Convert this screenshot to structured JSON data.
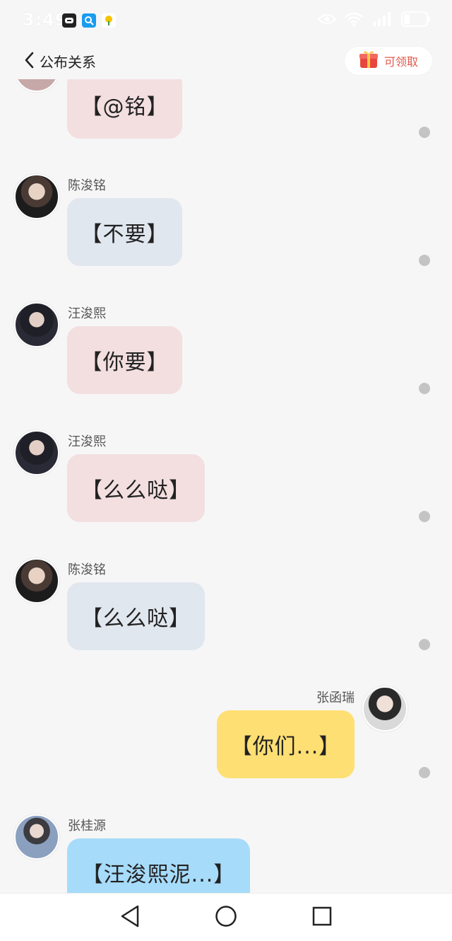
{
  "status": {
    "time": "3:49",
    "apps": [
      "meituan-icon",
      "qq-browser-icon",
      "tencent-news-icon"
    ],
    "right_icons": [
      "eye-icon",
      "wifi-icon",
      "signal-icon",
      "battery-icon"
    ]
  },
  "header": {
    "back_label": "公布关系",
    "claim_label": "可领取"
  },
  "messages": [
    {
      "name": "",
      "text": "【@铭】",
      "side": "left",
      "bubble_color": "#f3dfe0"
    },
    {
      "name": "陈浚铭",
      "text": "【不要】",
      "side": "left",
      "bubble_color": "#e1e7ef"
    },
    {
      "name": "汪浚熙",
      "text": "【你要】",
      "side": "left",
      "bubble_color": "#f3dfe0"
    },
    {
      "name": "汪浚熙",
      "text": "【么么哒】",
      "side": "left",
      "bubble_color": "#f3dfe0"
    },
    {
      "name": "陈浚铭",
      "text": "【么么哒】",
      "side": "left",
      "bubble_color": "#e1e7ef"
    },
    {
      "name": "张函瑞",
      "text": "【你们...】",
      "side": "right",
      "bubble_color": "#fedf73"
    },
    {
      "name": "张桂源",
      "text": "【汪浚熙泥...】",
      "side": "left",
      "bubble_color": "#a7dbfa"
    }
  ],
  "bottom_nav": [
    "back-triangle-icon",
    "home-circle-icon",
    "recents-square-icon"
  ]
}
